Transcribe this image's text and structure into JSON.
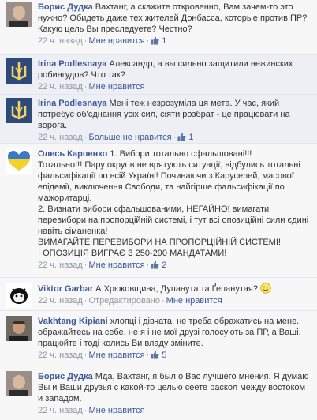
{
  "comments": [
    {
      "author": "Борис Дудка",
      "text": "Вахтанг, а скажите откровенно, Вам зачем-то это нужно? Обидеть даже тех жителей Донбасса, которые против ПР? Какую цель Вы преследуете? Честно?",
      "time": "22 ч. назад",
      "dislike": "Мне нравится",
      "likes": "1"
    },
    {
      "author": "Irina Podlesnaya",
      "text": "Александр, а вы сильно защитили нежинских робингудов? Что так?",
      "time": "22 ч. назад",
      "dislike": "Мне нравится"
    },
    {
      "author": "Irina Podlesnaya",
      "text": "Мені теж незрозуміла ця мета. У час, який потребує об'єднання усіх сил, сіяти розбрат - це працювати на ворога.",
      "time": "22 ч. назад",
      "dislike": "Больше не нравится",
      "likes": "1"
    },
    {
      "author": "Олесь Карпенко",
      "text_lines": [
        "1. Вибори тотально сфальшовані!!!",
        "Тотально!!! Пару округів не врятують ситуації, відбулись тотальні фальсифікації по всій Україні! Починаючи з Каруселей, масової епідемії, виключення Свободи, та найгірше фальсифікації по мажоритарці.",
        "2. Визнати вибори сфальшованими, НЕГАЙНО! вимагати перевибори на пропорційній системі, і тут всі опозиційні сили єдині навіть сіманенка!",
        "ВИМАГАЙТЕ ПЕРЕВИБОРИ НА ПРОПОРЦІЙНІЙ СИСТЕМІ!",
        "І ОПОЗИЦІЯ ВИГРАЄ З 250-290 МАНДАТАМИ!"
      ],
      "time": "22 ч. назад",
      "dislike": "Мне нравится",
      "likes": "2"
    },
    {
      "author": "Viktor Garbar",
      "text": "А Хрюковщина, Дупанута та Ґепанутая?",
      "time": "22 ч. назад",
      "mark_label": "Отредактировано",
      "dislike": "Мне нравится"
    },
    {
      "author": "Vakhtang Kipiani",
      "text": "хлопці і дівчата, не треба ображатись на мене. ображайтесь на себе. не я і не мої друзі голосують за ПР, а Ваші. працюйте і тоді колись Ви владу зміните.",
      "time": "22 ч. назад",
      "dislike": "Мне нравится",
      "likes": "5"
    },
    {
      "author": "Борис Дудка",
      "text": "Мда, Вахтанг, я был о Вас лучшего мнения. Я думаю Вы и Ваши друзья с какой-то целью сеете раскол между востоком и западом.",
      "time": "22 ч. назад",
      "dislike": "Мне нравится"
    }
  ],
  "icons": {
    "like": "thumbs-up-icon",
    "smiley": "smiley-icon"
  },
  "colors": {
    "link": "#3b5998",
    "meta": "#9197a3",
    "row_bg_alt": "#edeff4"
  }
}
